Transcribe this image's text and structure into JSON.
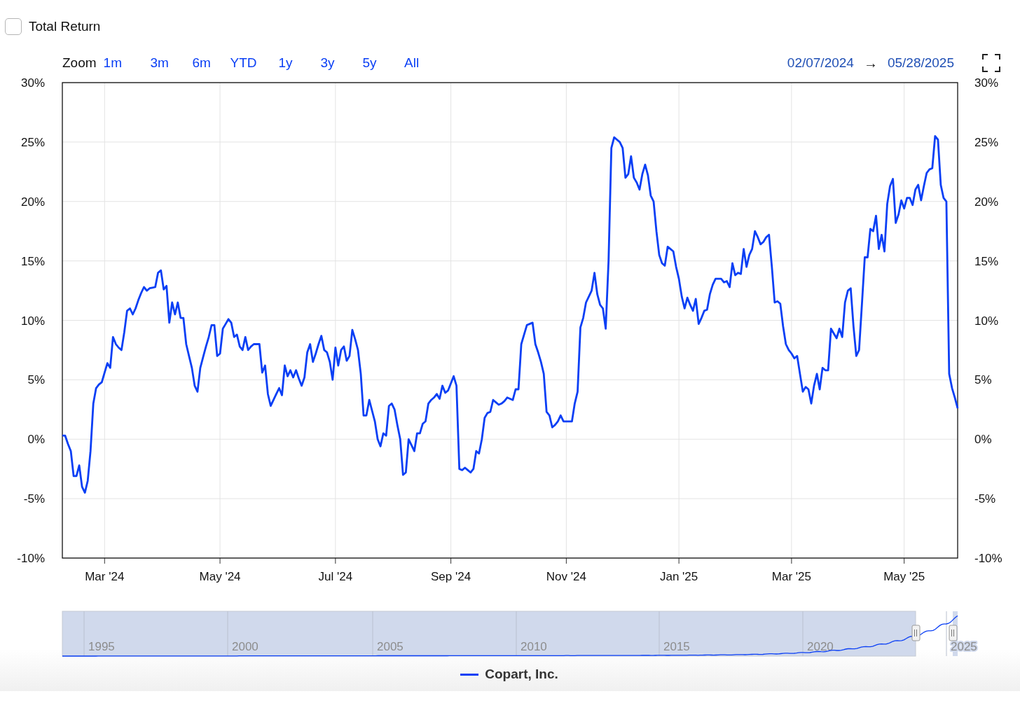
{
  "total_return": {
    "label": "Total Return",
    "checked": false
  },
  "zoom": {
    "label": "Zoom",
    "buttons": [
      {
        "label": "1m",
        "selected": false
      },
      {
        "label": "3m",
        "selected": false
      },
      {
        "label": "6m",
        "selected": false
      },
      {
        "label": "YTD",
        "selected": false
      },
      {
        "label": "1y",
        "selected": false
      },
      {
        "label": "3y",
        "selected": false
      },
      {
        "label": "5y",
        "selected": false
      },
      {
        "label": "All",
        "selected": false
      }
    ]
  },
  "date_range": {
    "from": "02/07/2024",
    "arrow": "→",
    "to": "05/28/2025"
  },
  "chart": {
    "chart_data": {
      "type": "line",
      "grid": true,
      "ylim": [
        -10,
        30
      ],
      "yticks": [
        {
          "value": 30,
          "label": "30%"
        },
        {
          "value": 25,
          "label": "25%"
        },
        {
          "value": 20,
          "label": "20%"
        },
        {
          "value": 15,
          "label": "15%"
        },
        {
          "value": 10,
          "label": "10%"
        },
        {
          "value": 5,
          "label": "5%"
        },
        {
          "value": 0,
          "label": "0%"
        },
        {
          "value": -5,
          "label": "-5%"
        },
        {
          "value": -10,
          "label": "-10%"
        }
      ],
      "categories": [
        null,
        null,
        null,
        null,
        null,
        null,
        null,
        null,
        null,
        null,
        null,
        null,
        null,
        null,
        null,
        "Mar '24",
        null,
        null,
        null,
        null,
        null,
        null,
        null,
        null,
        null,
        null,
        null,
        null,
        null,
        null,
        null,
        null,
        null,
        null,
        null,
        null,
        null,
        null,
        null,
        null,
        null,
        null,
        null,
        null,
        null,
        null,
        null,
        null,
        null,
        null,
        null,
        null,
        null,
        null,
        null,
        null,
        "May '24",
        null,
        null,
        null,
        null,
        null,
        null,
        null,
        null,
        null,
        null,
        null,
        null,
        null,
        null,
        null,
        null,
        null,
        null,
        null,
        null,
        null,
        null,
        null,
        null,
        null,
        null,
        null,
        null,
        null,
        null,
        null,
        null,
        null,
        null,
        null,
        null,
        null,
        null,
        null,
        null,
        "Jul '24",
        null,
        null,
        null,
        null,
        null,
        null,
        null,
        null,
        null,
        null,
        null,
        null,
        null,
        null,
        null,
        null,
        null,
        null,
        null,
        null,
        null,
        null,
        null,
        null,
        null,
        null,
        null,
        null,
        null,
        null,
        null,
        null,
        null,
        null,
        null,
        null,
        null,
        null,
        null,
        null,
        "Sep '24",
        null,
        null,
        null,
        null,
        null,
        null,
        null,
        null,
        null,
        null,
        null,
        null,
        null,
        null,
        null,
        null,
        null,
        null,
        null,
        null,
        null,
        null,
        null,
        null,
        null,
        null,
        null,
        null,
        null,
        null,
        null,
        null,
        null,
        null,
        null,
        null,
        null,
        null,
        null,
        null,
        "Nov '24",
        null,
        null,
        null,
        null,
        null,
        null,
        null,
        null,
        null,
        null,
        null,
        null,
        null,
        null,
        null,
        null,
        null,
        null,
        null,
        null,
        null,
        null,
        null,
        null,
        null,
        null,
        null,
        null,
        null,
        null,
        null,
        null,
        null,
        null,
        null,
        null,
        null,
        null,
        null,
        "Jan '25",
        null,
        null,
        null,
        null,
        null,
        null,
        null,
        null,
        null,
        null,
        null,
        null,
        null,
        null,
        null,
        null,
        null,
        null,
        null,
        null,
        null,
        null,
        null,
        null,
        null,
        null,
        null,
        null,
        null,
        null,
        null,
        null,
        null,
        null,
        null,
        null,
        null,
        null,
        null,
        "Mar '25",
        null,
        null,
        null,
        null,
        null,
        null,
        null,
        null,
        null,
        null,
        null,
        null,
        null,
        null,
        null,
        null,
        null,
        null,
        null,
        null,
        null,
        null,
        null,
        null,
        null,
        null,
        null,
        null,
        null,
        null,
        null,
        null,
        null,
        null,
        null,
        null,
        null,
        null,
        null,
        "May '25",
        null,
        null,
        null,
        null,
        null,
        null,
        null,
        null,
        null,
        null,
        null,
        null,
        null,
        null,
        null,
        null,
        null,
        null,
        null
      ],
      "series": [
        {
          "name": "Copart, Inc.",
          "color": "#0a3ff5",
          "values": [
            0.3,
            0.3,
            -0.4,
            -1,
            -3.1,
            -3.1,
            -2.2,
            -4,
            -4.5,
            -3.5,
            -1,
            3,
            4.3,
            4.6,
            4.8,
            5.6,
            6.4,
            6,
            8.6,
            8,
            7.7,
            7.5,
            9,
            10.8,
            11,
            10.5,
            11,
            11.7,
            12.3,
            12.8,
            12.5,
            12.7,
            12.75,
            12.8,
            14,
            14.2,
            12.6,
            12.9,
            9.8,
            11.5,
            10.5,
            11.5,
            10.2,
            10.2,
            8,
            7,
            6,
            4.5,
            4,
            6,
            6.9,
            7.8,
            8.6,
            9.6,
            9.6,
            7,
            7.2,
            9.3,
            9.7,
            10.1,
            9.8,
            8.6,
            8.8,
            7.8,
            7.5,
            8.6,
            7.5,
            7.8,
            8,
            8,
            8,
            5.6,
            6.2,
            3.8,
            2.8,
            3.3,
            3.8,
            4.3,
            3.7,
            6.2,
            5.3,
            5.8,
            5.2,
            5.8,
            5.1,
            4.5,
            5.2,
            7.3,
            8,
            6.5,
            7.2,
            8,
            8.7,
            7.5,
            7.3,
            6.5,
            5,
            7.7,
            6.2,
            7.5,
            7.8,
            6.6,
            7,
            9.2,
            8.4,
            7.5,
            5.5,
            2,
            2,
            3.3,
            2.4,
            1.5,
            0,
            -0.6,
            0.5,
            0.3,
            2.8,
            3,
            2.5,
            1.2,
            0,
            -3,
            -2.8,
            0,
            -0.5,
            -1,
            0.5,
            0.5,
            1.3,
            1.5,
            3,
            3.3,
            3.5,
            3.8,
            3.4,
            4.5,
            3.9,
            4.1,
            4.7,
            5.3,
            4.5,
            -2.5,
            -2.6,
            -2.4,
            -2.6,
            -2.8,
            -2.5,
            -1,
            -1.2,
            0,
            1.8,
            2.2,
            2.3,
            3.3,
            3.1,
            2.9,
            3,
            3.2,
            3.5,
            3.4,
            3.3,
            4.2,
            4.2,
            8,
            8.8,
            9.6,
            9.7,
            9.8,
            8,
            7.3,
            6.5,
            5.5,
            2.3,
            2,
            1,
            1.2,
            1.5,
            2,
            1.5,
            1.5,
            1.5,
            1.5,
            3,
            4,
            9.4,
            10.2,
            11.5,
            12,
            12.5,
            14,
            12.2,
            11.3,
            11,
            9.3,
            15,
            24.5,
            25.4,
            25.2,
            25,
            24.5,
            22,
            22.3,
            23.8,
            22,
            21.6,
            21,
            22.3,
            23.1,
            22.2,
            20.5,
            20,
            17.5,
            15.5,
            14.8,
            14.6,
            16.2,
            16,
            15.8,
            14.5,
            13.5,
            12,
            11,
            11.9,
            11.3,
            10.8,
            11.8,
            9.7,
            10.2,
            10.8,
            10.9,
            12.2,
            13,
            13.5,
            13.5,
            13.5,
            13.2,
            13.3,
            12.8,
            14.8,
            13.8,
            14,
            13.9,
            16,
            14.5,
            15.5,
            16,
            17.5,
            17,
            16.4,
            16.6,
            17,
            17.2,
            14.5,
            11.5,
            11.6,
            11.4,
            9.5,
            8,
            7.5,
            7.2,
            6.8,
            7,
            5.5,
            4,
            4.4,
            4.2,
            3,
            4.5,
            5.5,
            4.2,
            6,
            5.8,
            5.8,
            9.3,
            8.9,
            8.5,
            9.3,
            8.6,
            11.5,
            12.5,
            12.7,
            9.5,
            7,
            7.5,
            11.4,
            15.3,
            15.3,
            17.7,
            17.5,
            18.8,
            16,
            17.2,
            15.8,
            19.8,
            21.3,
            21.9,
            18.2,
            18.9,
            20.1,
            19.4,
            20.3,
            20.3,
            19.7,
            21,
            21.4,
            20.1,
            21.3,
            22.4,
            22.7,
            22.8,
            25.5,
            25.2,
            21.4,
            20.3,
            20,
            5.5,
            4.3,
            3.5,
            2.6
          ]
        }
      ]
    },
    "right_axis_labels": [
      "30%",
      "25%",
      "20%",
      "15%",
      "10%",
      "5%",
      "0%",
      "-5%",
      "-10%"
    ]
  },
  "navigator": {
    "year_labels": [
      "1995",
      "2000",
      "2005",
      "2010",
      "2015",
      "2020",
      "2025"
    ]
  }
}
